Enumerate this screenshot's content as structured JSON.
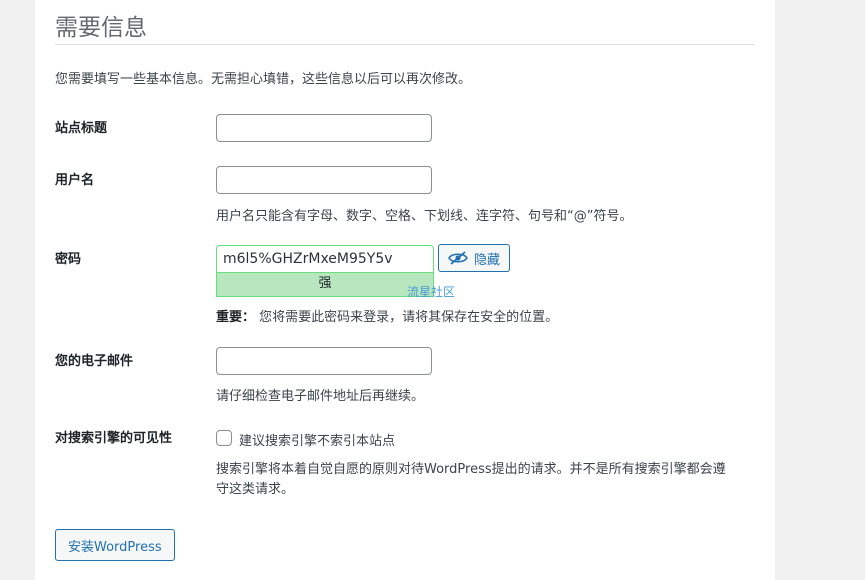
{
  "heading": "需要信息",
  "intro": "您需要填写一些基本信息。无需担心填错，这些信息以后可以再次修改。",
  "fields": {
    "site_title": {
      "label": "站点标题",
      "value": ""
    },
    "username": {
      "label": "用户名",
      "value": "",
      "hint": "用户名只能含有字母、数字、空格、下划线、连字符、句号和“@”符号。"
    },
    "password": {
      "label": "密码",
      "value": "m6l5%GHZrMxeM95Y5v",
      "strength": "强",
      "hide_label": "隐藏",
      "important_label": "重要：",
      "important_text": "您将需要此密码来登录，请将其保存在安全的位置。",
      "strength_color": "#b8e6bf",
      "border_color": "#68de7c"
    },
    "email": {
      "label": "您的电子邮件",
      "value": "",
      "hint": "请仔细检查电子邮件地址后再继续。"
    },
    "visibility": {
      "label": "对搜索引擎的可见性",
      "checkbox_label": "建议搜索引擎不索引本站点",
      "checked": false,
      "hint": "搜索引擎将本着自觉自愿的原则对待WordPress提出的请求。并不是所有搜索引擎都会遵守这类请求。"
    }
  },
  "watermark": "流星社区",
  "install_button": "安装WordPress",
  "colors": {
    "accent": "#2271b1",
    "background": "#f0f0f1"
  },
  "icons": {
    "hide": "eye-slash-icon"
  }
}
